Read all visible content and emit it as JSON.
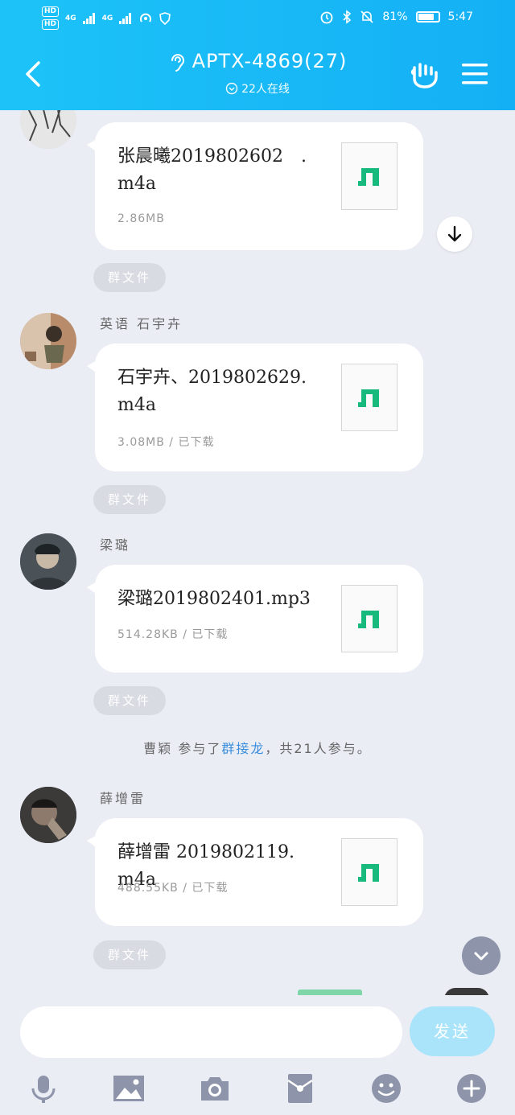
{
  "status": {
    "net1": "4G",
    "net2": "4G",
    "battery": "81%",
    "battery_level": 0.81,
    "time": "5:47"
  },
  "header": {
    "title": "APTX-4869(27)",
    "online": "22人在线"
  },
  "messages": [
    {
      "sender": "",
      "file": "张晨曦2019802602　.m4a",
      "meta": "2.86MB",
      "tag": "群文件"
    },
    {
      "sender": "英语 石宇卉",
      "file": "石宇卉、2019802629.m4a",
      "meta": "3.08MB / 已下载",
      "tag": "群文件"
    },
    {
      "sender": "梁璐",
      "file": "梁璐2019802401.mp3",
      "meta": "514.28KB / 已下载",
      "tag": "群文件"
    },
    {
      "sender": "薛增雷",
      "file": "薛增雷 2019802119.m4a",
      "meta": "488.55KB / 已下载",
      "tag": "群文件"
    }
  ],
  "system": {
    "prefix": "曹颖 参与了",
    "link": "群接龙",
    "suffix": "，共21人参与。"
  },
  "input": {
    "placeholder": "",
    "send_label": "发送"
  },
  "colors": {
    "header": "#14b0f5",
    "accent_link": "#3a8edc",
    "music_icon": "#18b97c"
  },
  "icons": [
    "back-icon",
    "ear-icon",
    "gesture-icon",
    "menu-icon",
    "download-icon",
    "chevron-down-icon",
    "mic-icon",
    "image-icon",
    "camera-icon",
    "red-packet-icon",
    "emoji-icon",
    "plus-icon"
  ]
}
